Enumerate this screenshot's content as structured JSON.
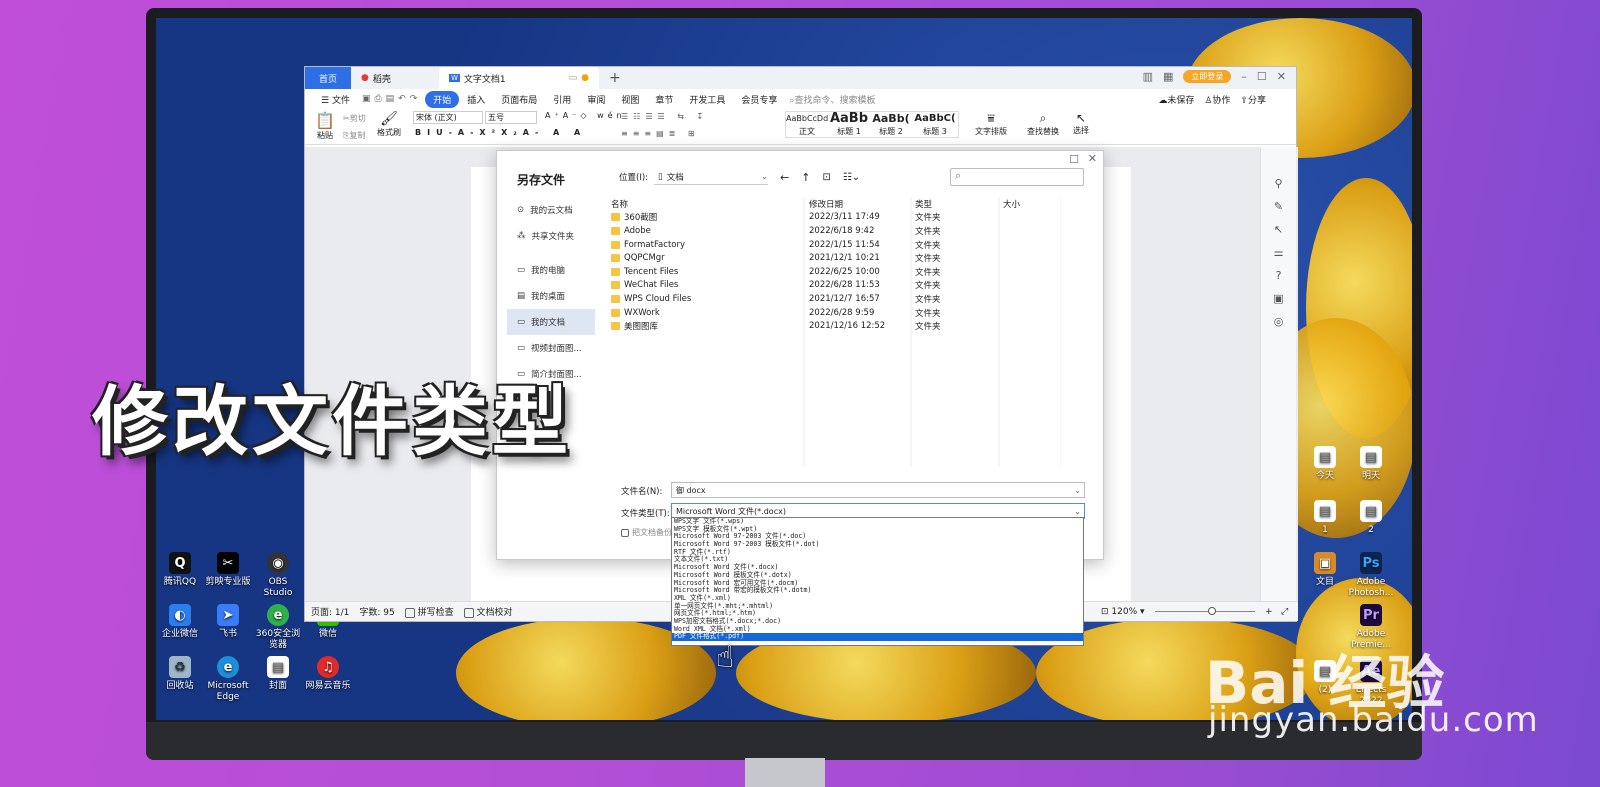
{
  "overlay": {
    "title": "修改文件类型",
    "watermark": "Bai 经验",
    "watermark_url": "jingyan.baidu.com"
  },
  "desktop": {
    "left_icons": [
      {
        "label": "腾讯QQ"
      },
      {
        "label": "剪映专业版"
      },
      {
        "label": "OBS Studio"
      },
      {
        "label": "企业微信"
      },
      {
        "label": "飞书"
      },
      {
        "label": "360安全浏览器"
      },
      {
        "label": "微信"
      },
      {
        "label": "回收站"
      },
      {
        "label": "Microsoft Edge"
      },
      {
        "label": "封面"
      },
      {
        "label": "网易云音乐"
      }
    ],
    "right_icons": [
      {
        "label": "今天"
      },
      {
        "label": "明天"
      },
      {
        "label": "1"
      },
      {
        "label": "2"
      },
      {
        "label": "文目"
      },
      {
        "label": "Adobe Photosh..."
      },
      {
        "label": "Adobe Premie..."
      },
      {
        "label": "(2)"
      },
      {
        "label": "Effects 2022"
      }
    ]
  },
  "wps": {
    "tabs": {
      "home": "首页",
      "straw": "稻壳",
      "doc": "文字文档1"
    },
    "login": "立即登录",
    "menu": [
      "文件",
      "开始",
      "插入",
      "页面布局",
      "引用",
      "审阅",
      "视图",
      "章节",
      "开发工具",
      "会员专享"
    ],
    "search_placeholder": "查找命令、搜索模板",
    "actions": {
      "unsaved": "未保存",
      "collab": "协作",
      "share": "分享"
    },
    "ribbon": {
      "paste": "粘贴",
      "cut": "剪切",
      "copy": "复制",
      "format_painter": "格式刷",
      "font": "宋体 (正文)",
      "size": "五号",
      "styles": [
        {
          "preview": "AaBbCcDd",
          "name": "正文"
        },
        {
          "preview": "AaBb",
          "name": "标题 1"
        },
        {
          "preview": "AaBb(",
          "name": "标题 2"
        },
        {
          "preview": "AaBbC(",
          "name": "标题 3"
        }
      ],
      "text_layout": "文字排版",
      "find_replace": "查找替换",
      "select": "选择"
    },
    "status": {
      "page": "页面: 1/1",
      "words": "字数: 95",
      "spell": "拼写检查",
      "proof": "文档校对",
      "zoom": "120%"
    }
  },
  "dialog": {
    "title": "另存文件",
    "location_label": "位置(I):",
    "location_value": "文档",
    "sidebar": [
      "我的云文档",
      "共享文件夹",
      "我的电脑",
      "我的桌面",
      "我的文档",
      "视频封面图...",
      "简介封面图..."
    ],
    "columns": {
      "name": "名称",
      "date": "修改日期",
      "type": "类型",
      "size": "大小"
    },
    "files": [
      {
        "name": "360截图",
        "date": "2022/3/11 17:49",
        "type": "文件夹"
      },
      {
        "name": "Adobe",
        "date": "2022/6/18 9:42",
        "type": "文件夹"
      },
      {
        "name": "FormatFactory",
        "date": "2022/1/15 11:54",
        "type": "文件夹"
      },
      {
        "name": "QQPCMgr",
        "date": "2021/12/1 10:21",
        "type": "文件夹"
      },
      {
        "name": "Tencent Files",
        "date": "2022/6/25 10:00",
        "type": "文件夹"
      },
      {
        "name": "WeChat Files",
        "date": "2022/6/28 11:53",
        "type": "文件夹"
      },
      {
        "name": "WPS Cloud Files",
        "date": "2021/12/7 16:57",
        "type": "文件夹"
      },
      {
        "name": "WXWork",
        "date": "2022/6/28 9:59",
        "type": "文件夹"
      },
      {
        "name": "美图图库",
        "date": "2021/12/16 12:52",
        "type": "文件夹"
      }
    ],
    "filename_label": "文件名(N):",
    "filename_value": "御 docx",
    "filetype_label": "文件类型(T):",
    "filetype_value": "Microsoft Word 文件(*.docx)",
    "backup_label": "把文档备份",
    "filetype_options": [
      "WPS文字 文件(*.wps)",
      "WPS文字 模板文件(*.wpt)",
      "Microsoft Word 97-2003 文件(*.doc)",
      "Microsoft Word 97-2003 模板文件(*.dot)",
      "RTF 文件(*.rtf)",
      "文本文件(*.txt)",
      "Microsoft Word 文件(*.docx)",
      "Microsoft Word 模板文件(*.dotx)",
      "Microsoft Word 宏可用文件(*.docm)",
      "Microsoft Word 带宏的模板文件(*.dotm)",
      "XML 文件(*.xml)",
      "单一网页文件(*.mht;*.mhtml)",
      "网页文件(*.html;*.htm)",
      "WPS加密文档格式(*.docx;*.doc)",
      "Word XML 文档(*.xml)",
      "PDF 文件格式(*.pdf)"
    ],
    "selected_option": 15
  }
}
